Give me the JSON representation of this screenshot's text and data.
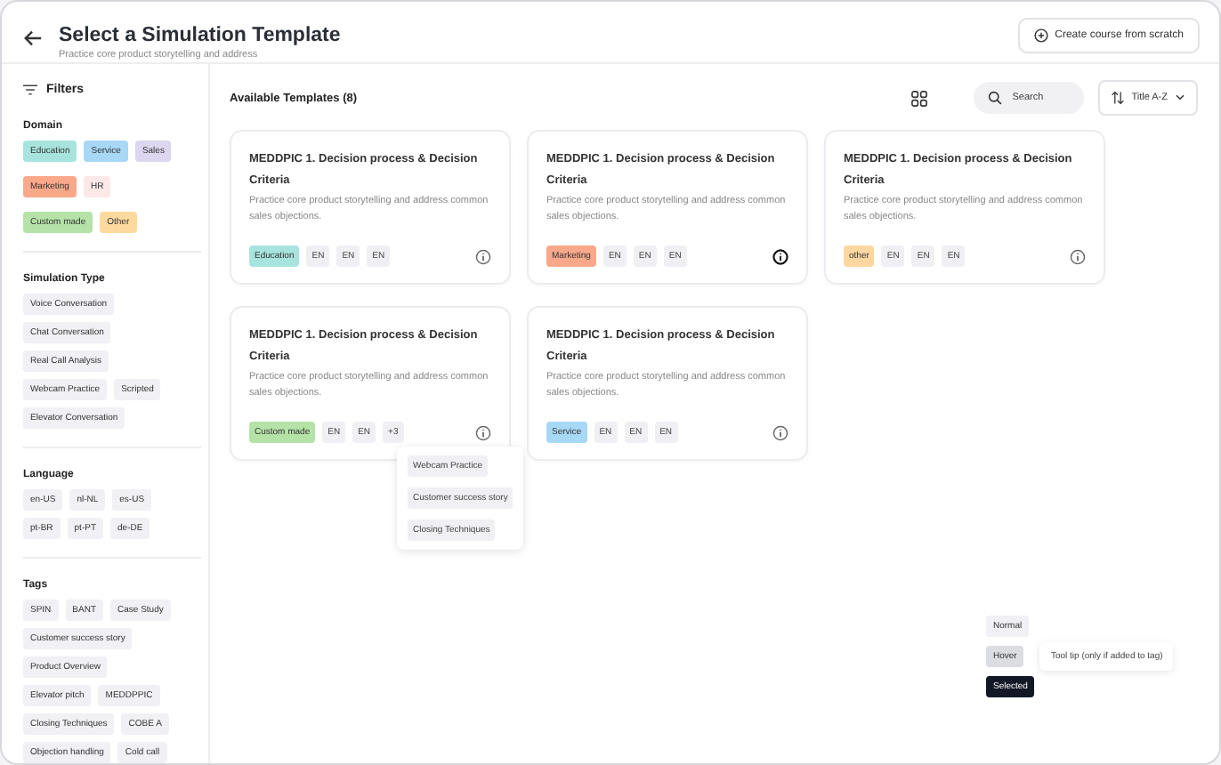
{
  "header": {
    "title": "Select a Simulation Template",
    "subtitle": "Practice core product storytelling and address",
    "create_button": "Create course from scratch"
  },
  "filters": {
    "title": "Filters",
    "sections": [
      {
        "title": "Domain",
        "chips": [
          {
            "label": "Education",
            "color": "#a8e4de"
          },
          {
            "label": "Service",
            "color": "#a7d8f5"
          },
          {
            "label": "Sales",
            "color": "#dcd6ef"
          },
          {
            "label": "Marketing",
            "color": "#f9a88a"
          },
          {
            "label": "HR",
            "color": "#fde8e8"
          },
          {
            "label": "Custom made",
            "color": "#b5e3a7"
          },
          {
            "label": "Other",
            "color": "#fdd9a0"
          }
        ]
      },
      {
        "title": "Simulation Type",
        "chips": [
          {
            "label": "Voice Conversation"
          },
          {
            "label": "Chat Conversation"
          },
          {
            "label": "Real Call Analysis"
          },
          {
            "label": "Webcam Practice"
          },
          {
            "label": "Scripted"
          },
          {
            "label": "Elevator Conversation"
          }
        ]
      },
      {
        "title": "Language",
        "chips": [
          {
            "label": "en-US"
          },
          {
            "label": "nl-NL"
          },
          {
            "label": "es-US"
          },
          {
            "label": "pt-BR"
          },
          {
            "label": "pt-PT"
          },
          {
            "label": "de-DE"
          }
        ]
      },
      {
        "title": "Tags",
        "chips": [
          {
            "label": "SPIN"
          },
          {
            "label": "BANT"
          },
          {
            "label": "Case Study"
          },
          {
            "label": "Customer success story"
          },
          {
            "label": "Product Overview"
          },
          {
            "label": "Elevator pitch"
          },
          {
            "label": "MEDDPPIC"
          },
          {
            "label": "Closing Techniques"
          },
          {
            "label": "COBE A"
          },
          {
            "label": "Objection handling"
          },
          {
            "label": "Cold call"
          }
        ]
      }
    ]
  },
  "main": {
    "heading": "Available Templates (8)",
    "search_placeholder": "Search",
    "sort": "Title A-Z"
  },
  "cards": [
    {
      "title": "MEDDPIC 1. Decision process & Decision Criteria",
      "description": "Practice core product storytelling and address common sales objections.",
      "tag": {
        "label": "Education",
        "color": "#a8e4de"
      },
      "chips": [
        "EN",
        "EN",
        "EN"
      ],
      "info_active": false
    },
    {
      "title": "MEDDPIC 1. Decision process & Decision Criteria",
      "description": "Practice core product storytelling and address common sales objections.",
      "tag": {
        "label": "Marketing",
        "color": "#f9a88a"
      },
      "chips": [
        "EN",
        "EN",
        "EN"
      ],
      "info_active": true
    },
    {
      "title": "MEDDPIC 1. Decision process & Decision Criteria",
      "description": "Practice core product storytelling and address common sales objections.",
      "tag": {
        "label": "other",
        "color": "#fdd7a0"
      },
      "chips": [
        "EN",
        "EN",
        "EN"
      ],
      "info_active": false
    },
    {
      "title": "MEDDPIC 1. Decision process & Decision Criteria",
      "description": "Practice core product storytelling and address common sales objections.",
      "tag": {
        "label": "Custom made",
        "color": "#b5e3a7"
      },
      "chips": [
        "EN",
        "EN",
        "+3"
      ],
      "info_active": false,
      "popover": [
        "Webcam Practice",
        "Customer success story",
        "Closing Techniques"
      ]
    },
    {
      "title": "MEDDPIC 1. Decision process & Decision Criteria",
      "description": "Practice core product storytelling and address common sales objections.",
      "tag": {
        "label": "Service",
        "color": "#a7d8f5"
      },
      "chips": [
        "EN",
        "EN",
        "EN"
      ],
      "info_active": false
    }
  ],
  "legend": {
    "states": [
      {
        "label": "Normal",
        "kind": "normal"
      },
      {
        "label": "Hover",
        "kind": "hover"
      },
      {
        "label": "Selected",
        "kind": "selected"
      }
    ],
    "tooltip": "Tool tip (only if added to tag)"
  }
}
